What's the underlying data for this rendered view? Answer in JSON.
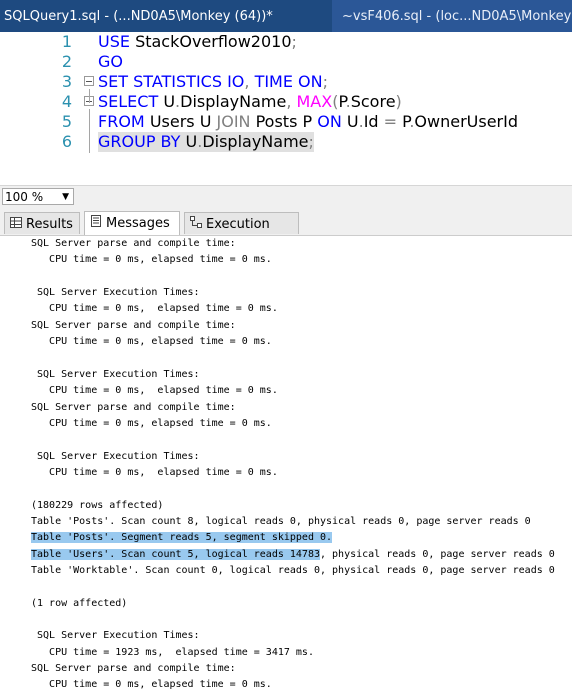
{
  "tabs": {
    "active_label": "SQLQuery1.sql - (...ND0A5\\Monkey (64))*",
    "inactive_label": "~vsF406.sql - (loc...ND0A5\\Monkey"
  },
  "editor": {
    "lines": [
      {
        "num": "1",
        "parts": [
          [
            "kw",
            "USE "
          ],
          [
            "tx",
            "StackOverflow2010"
          ],
          [
            "gr",
            ";"
          ]
        ]
      },
      {
        "num": "2",
        "parts": [
          [
            "kw",
            "GO"
          ]
        ]
      },
      {
        "num": "3",
        "parts": [
          [
            "kw",
            "SET STATISTICS IO"
          ],
          [
            "gr",
            ", "
          ],
          [
            "kw",
            "TIME ON"
          ],
          [
            "gr",
            ";"
          ]
        ]
      },
      {
        "num": "4",
        "parts": [
          [
            "kw",
            "SELECT "
          ],
          [
            "tx",
            "U"
          ],
          [
            "gr",
            "."
          ],
          [
            "tx",
            "DisplayName"
          ],
          [
            "gr",
            ", "
          ],
          [
            "fn",
            "MAX"
          ],
          [
            "gr",
            "("
          ],
          [
            "tx",
            "P"
          ],
          [
            "gr",
            "."
          ],
          [
            "tx",
            "Score"
          ],
          [
            "gr",
            ")"
          ]
        ]
      },
      {
        "num": "5",
        "parts": [
          [
            "kw",
            "FROM "
          ],
          [
            "tx",
            "Users U "
          ],
          [
            "gr",
            "JOIN "
          ],
          [
            "tx",
            "Posts P "
          ],
          [
            "kw",
            "ON "
          ],
          [
            "tx",
            "U"
          ],
          [
            "gr",
            "."
          ],
          [
            "tx",
            "Id "
          ],
          [
            "gr",
            "= "
          ],
          [
            "tx",
            "P"
          ],
          [
            "gr",
            "."
          ],
          [
            "tx",
            "OwnerUserId"
          ]
        ]
      },
      {
        "num": "6",
        "parts": [
          [
            "kw",
            "GROUP BY "
          ],
          [
            "tx",
            "U"
          ],
          [
            "gr",
            "."
          ],
          [
            "tx",
            "DisplayName"
          ],
          [
            "gr",
            ";"
          ]
        ]
      }
    ]
  },
  "zoom": {
    "value": "100 %"
  },
  "result_tabs": {
    "results": "Results",
    "messages": "Messages",
    "plan": "Execution plan"
  },
  "messages": [
    {
      "text": "SQL Server parse and compile time: "
    },
    {
      "text": "   CPU time = 0 ms, elapsed time = 0 ms."
    },
    {
      "text": ""
    },
    {
      "text": " SQL Server Execution Times:"
    },
    {
      "text": "   CPU time = 0 ms,  elapsed time = 0 ms."
    },
    {
      "text": "SQL Server parse and compile time: "
    },
    {
      "text": "   CPU time = 0 ms, elapsed time = 0 ms."
    },
    {
      "text": ""
    },
    {
      "text": " SQL Server Execution Times:"
    },
    {
      "text": "   CPU time = 0 ms,  elapsed time = 0 ms."
    },
    {
      "text": "SQL Server parse and compile time: "
    },
    {
      "text": "   CPU time = 0 ms, elapsed time = 0 ms."
    },
    {
      "text": ""
    },
    {
      "text": " SQL Server Execution Times:"
    },
    {
      "text": "   CPU time = 0 ms,  elapsed time = 0 ms."
    },
    {
      "text": ""
    },
    {
      "text": "(180229 rows affected)"
    },
    {
      "text": "Table 'Posts'. Scan count 8, logical reads 0, physical reads 0, page server reads 0"
    },
    {
      "text": "Table 'Posts'. Segment reads 5, segment skipped 0.",
      "sel": "Table 'Posts'. Segment reads 5, segment skipped 0.",
      "rest": ""
    },
    {
      "text": "Table 'Users'. Scan count 5, logical reads 14783, physical reads 0, page server reads 0",
      "sel": "Table 'Users'. Scan count 5, logical reads 14783",
      "rest": ", physical reads 0, page server reads 0"
    },
    {
      "text": "Table 'Worktable'. Scan count 0, logical reads 0, physical reads 0, page server reads 0"
    },
    {
      "text": ""
    },
    {
      "text": "(1 row affected)"
    },
    {
      "text": ""
    },
    {
      "text": " SQL Server Execution Times:"
    },
    {
      "text": "   CPU time = 1923 ms,  elapsed time = 3417 ms."
    },
    {
      "text": "SQL Server parse and compile time: "
    },
    {
      "text": "   CPU time = 0 ms, elapsed time = 0 ms."
    }
  ]
}
